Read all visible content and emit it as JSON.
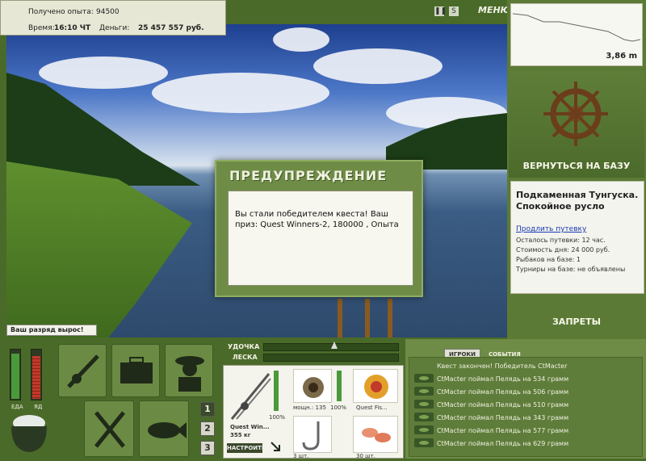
{
  "info": {
    "xp_label": "Получено опыта:",
    "xp_value": "94500",
    "time_label": "Время:",
    "time_value": "16:10 ЧТ",
    "money_label": "Деньги:",
    "money_value": "25 457 557 руб."
  },
  "topbar": {
    "pause_icon": "pause-icon",
    "sound_icon": "S",
    "menu_label": "МЕНЮ"
  },
  "depth": {
    "value": "3,86 m"
  },
  "right": {
    "return_label": "ВЕРНУТЬСЯ НА БАЗУ",
    "base_title": "Подкаменная Тунгуска. Спокойное русло",
    "extend_link": "Продлить путевку",
    "remaining": "Осталось путевки: 12 час.",
    "day_cost": "Стоимость дня: 24 000 руб.",
    "fishers": "Рыбаков на базе: 1",
    "tournaments": "Турниры на базе: не объявлены",
    "bans_label": "ЗАПРЕТЫ"
  },
  "dialog": {
    "title": "ПРЕДУПРЕЖДЕНИЕ",
    "message": "Вы стали победителем квеста! Ваш приз: Quest Winners-2, 180000 , Опыта"
  },
  "toast": {
    "text": "Ваш разряд вырос!"
  },
  "gauges": {
    "food_label": "ЕДА",
    "poison_label": "ЯД",
    "food_level": 0.9,
    "poison_level": 0.85
  },
  "rodbar": {
    "rod_label": "УДОЧКА",
    "line_label": "ЛЕСКА"
  },
  "slots": {
    "nums": [
      "1",
      "2",
      "3"
    ]
  },
  "tackle": {
    "rod_name": "Quest Win...",
    "rod_weight": "355 кг",
    "rod_percent": "100%",
    "reel_info": "мощн.: 135",
    "reel_percent": "100%",
    "line_name": "Quest Fis...",
    "hooks_count": "3 шт.",
    "bait_count": "30 шт.",
    "adjust_label": "НАСТРОИТЬ"
  },
  "chat": {
    "tab_players": "ИГРОКИ",
    "tab_events": "СОБЫТИЯ",
    "messages": [
      "Квест закончен! Победитель CtMacter",
      "CtMacter поймал Пелядь на 534 грамм",
      "CtMacter поймал Пелядь на 506 грамм",
      "CtMacter поймал Пелядь на 510 грамм",
      "CtMacter поймал Пелядь на 343 грамм",
      "CtMacter поймал Пелядь на 577 грамм",
      "CtMacter поймал Пелядь на 629 грамм"
    ]
  }
}
